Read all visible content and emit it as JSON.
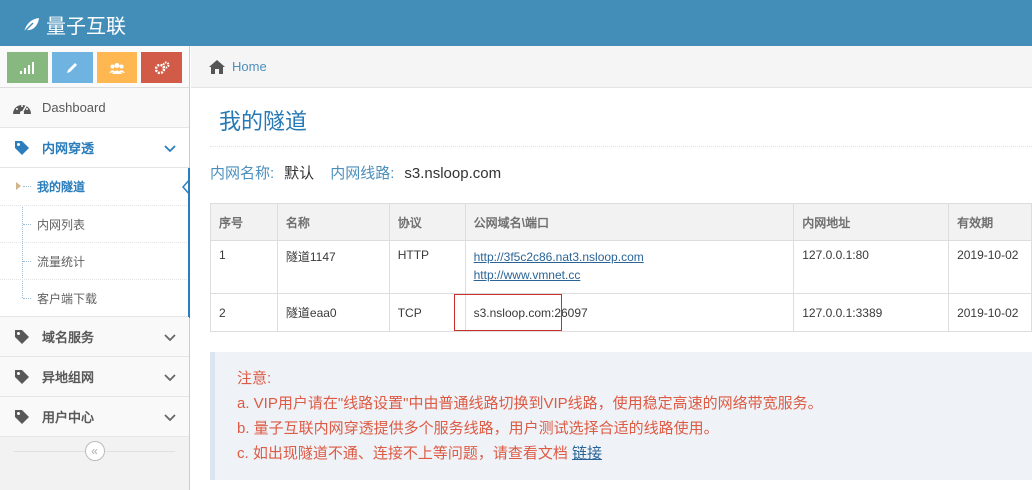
{
  "brand": {
    "name": "量子互联"
  },
  "breadcrumb": {
    "home": "Home"
  },
  "sidebar": {
    "dashboard": "Dashboard",
    "groups": [
      {
        "label": "内网穿透",
        "open": true
      },
      {
        "label": "域名服务"
      },
      {
        "label": "异地组网"
      },
      {
        "label": "用户中心"
      }
    ],
    "sub_items": [
      "我的隧道",
      "内网列表",
      "流量统计",
      "客户端下载"
    ],
    "collapse_glyph": "«"
  },
  "page": {
    "title": "我的隧道"
  },
  "info": {
    "name_label": "内网名称:",
    "name_value": "默认",
    "line_label": "内网线路:",
    "line_value": "s3.nsloop.com"
  },
  "table": {
    "headers": [
      "序号",
      "名称",
      "协议",
      "公网域名\\端口",
      "内网地址",
      "有效期"
    ],
    "rows": [
      {
        "index": "1",
        "name": "隧道1147",
        "protocol": "HTTP",
        "public": [
          "http://3f5c2c86.nat3.nsloop.com",
          "http://www.vmnet.cc"
        ],
        "local": "127.0.0.1:80",
        "expiry": "2019-10-02"
      },
      {
        "index": "2",
        "name": "隧道eaa0",
        "protocol": "TCP",
        "public": [
          "s3.nsloop.com:26097"
        ],
        "local": "127.0.0.1:3389",
        "expiry": "2019-10-02"
      }
    ]
  },
  "notice": {
    "title": "注意:",
    "line_a": "a. VIP用户请在\"线路设置\"中由普通线路切换到VIP线路，使用稳定高速的网络带宽服务。",
    "line_b": "b. 量子互联内网穿透提供多个服务线路，用户测试选择合适的线路使用。",
    "line_c": "c. 如出现隧道不通、连接不上等问题，请查看文档",
    "link": "链接"
  },
  "colors": {
    "navbar": "#438eb9",
    "accent": "#2679b5",
    "notice_text": "#dd5a43",
    "highlight_box": "#c9302c"
  }
}
